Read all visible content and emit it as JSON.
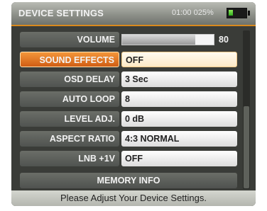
{
  "header": {
    "title": "DEVICE SETTINGS",
    "clock": "01:00",
    "battery_percent": "025%",
    "battery_level": 0.25,
    "battery_icon": "battery-icon"
  },
  "volume": {
    "label": "VOLUME",
    "value": "80",
    "level": 0.8
  },
  "settings": [
    {
      "label": "SOUND EFFECTS",
      "value": "OFF"
    },
    {
      "label": "OSD DELAY",
      "value": "3 Sec"
    },
    {
      "label": "AUTO LOOP",
      "value": "8"
    },
    {
      "label": "LEVEL ADJ.",
      "value": "0 dB"
    },
    {
      "label": "ASPECT RATIO",
      "value": "4:3 NORMAL"
    },
    {
      "label": "LNB +1V",
      "value": "OFF"
    }
  ],
  "selected_index": 0,
  "memory_info": "MEMORY INFO",
  "status": "Please Adjust Your Device Settings.",
  "colors": {
    "accent": "#d98a1e",
    "selected": "#e8772a"
  }
}
